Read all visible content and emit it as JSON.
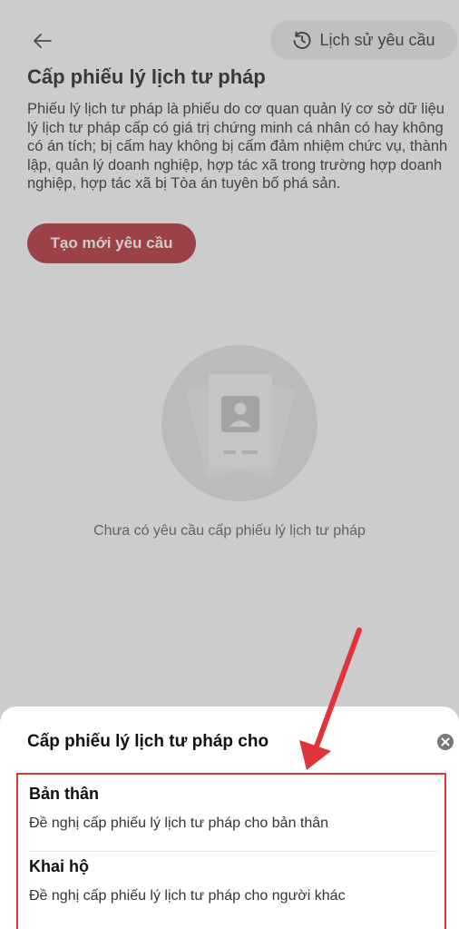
{
  "header": {
    "back_icon": "arrow-left-icon",
    "history_icon": "history-clock-icon",
    "history_label": "Lịch sử yêu cầu"
  },
  "page": {
    "title": "Cấp phiếu lý lịch tư pháp",
    "description": "Phiếu lý lịch tư pháp là phiếu do cơ quan quản lý cơ sở dữ liệu lý lịch tư pháp cấp có giá trị chứng minh cá nhân có hay không có án tích; bị cấm hay không bị cấm đảm nhiệm chức vụ, thành lập, quản lý doanh nghiệp, hợp tác xã trong trường hợp doanh nghiệp, hợp tác xã bị Tòa án tuyên bố phá sản.",
    "create_button_label": "Tạo mới yêu cầu",
    "empty_icon": "document-profile-icon",
    "empty_text": "Chưa có yêu cầu cấp phiếu lý lịch tư pháp"
  },
  "sheet": {
    "title": "Cấp phiếu lý lịch tư pháp cho",
    "close_icon": "close-circle-icon",
    "options": [
      {
        "title": "Bản thân",
        "description": "Đề nghị cấp phiếu lý lịch tư pháp cho bản thân"
      },
      {
        "title": "Khai hộ",
        "description": "Đề nghị cấp phiếu lý lịch tư pháp cho người khác"
      }
    ]
  },
  "colors": {
    "brand": "#b21f2a",
    "annotation": "#e0343b",
    "overlay": "rgba(120,120,120,0.38)"
  }
}
